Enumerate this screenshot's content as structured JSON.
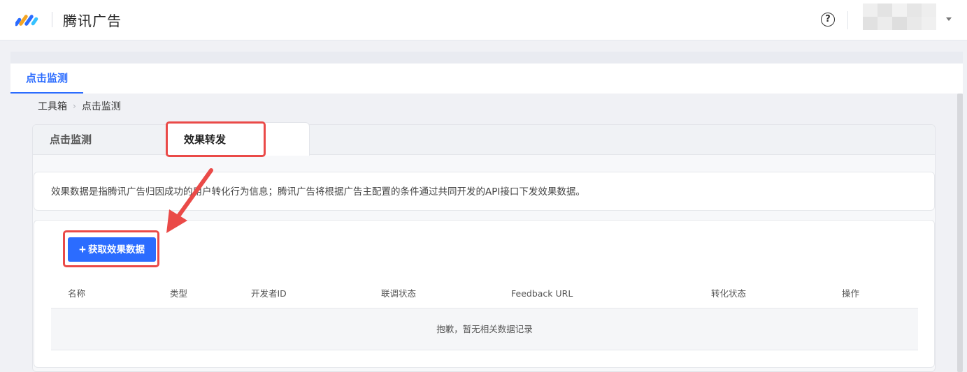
{
  "header": {
    "brand": "腾讯广告",
    "help_glyph": "?",
    "avatar_colors": [
      "#efefef",
      "#e3e3e3",
      "#f2f2f2",
      "#e6e6e6",
      "#eeeeee",
      "#e1e1e1",
      "#ececec",
      "#dedede",
      "#e9e9e9",
      "#f0f0f0"
    ]
  },
  "page_tab": {
    "label": "点击监测"
  },
  "breadcrumb": {
    "root": "工具箱",
    "separator": "›",
    "current": "点击监测"
  },
  "card_tabs": [
    {
      "label": "点击监测",
      "active": false
    },
    {
      "label": "效果转发",
      "active": true
    }
  ],
  "info": {
    "text": "效果数据是指腾讯广告归因成功的用户转化行为信息；腾讯广告将根据广告主配置的条件通过共同开发的API接口下发效果数据。"
  },
  "action": {
    "plus": "+",
    "label": "获取效果数据"
  },
  "table": {
    "columns": [
      "名称",
      "类型",
      "开发者ID",
      "联调状态",
      "Feedback URL",
      "转化状态",
      "操作"
    ],
    "empty_text": "抱歉，暂无相关数据记录"
  },
  "colors": {
    "accent": "#2b6cff",
    "annotation": "#ea4a48"
  }
}
